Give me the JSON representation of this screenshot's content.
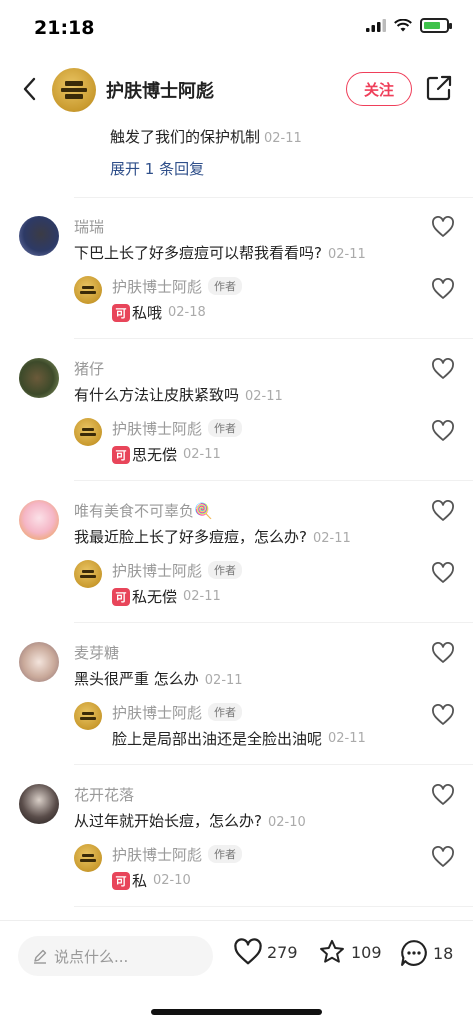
{
  "status_bar": {
    "time": "21:18"
  },
  "header": {
    "author_name": "护肤博士阿彪",
    "follow_label": "关注"
  },
  "previous_reply": {
    "text": "触发了我们的保护机制",
    "date": "02-11"
  },
  "expand_label": "展开 1 条回复",
  "author_tag": "作者",
  "comments": [
    {
      "user": "瑞瑞",
      "text": "下巴上长了好多痘痘可以帮我看看吗?",
      "date": "02-11",
      "reply": {
        "user": "护肤博士阿彪",
        "text": "私哦",
        "date": "02-18"
      }
    },
    {
      "user": "猪仔",
      "text": "有什么方法让皮肤紧致吗",
      "date": "02-11",
      "reply": {
        "user": "护肤博士阿彪",
        "text": "思无偿",
        "date": "02-11"
      }
    },
    {
      "user": "唯有美食不可辜负🍭",
      "text": "我最近脸上长了好多痘痘，怎么办?",
      "date": "02-11",
      "reply": {
        "user": "护肤博士阿彪",
        "text": "私无偿",
        "date": "02-11"
      }
    },
    {
      "user": "麦芽糖",
      "text": "黑头很严重 怎么办",
      "date": "02-11",
      "reply": {
        "user": "护肤博士阿彪",
        "text": "脸上是局部出油还是全脸出油呢",
        "date": "02-11"
      }
    },
    {
      "user": "花开花落",
      "text": "从过年就开始长痘，怎么办?",
      "date": "02-10",
      "reply": {
        "user": "护肤博士阿彪",
        "text": "私",
        "date": "02-10"
      }
    }
  ],
  "bottom_bar": {
    "input_placeholder": "说点什么...",
    "likes": "279",
    "favorites": "109",
    "comments": "18"
  },
  "colors": {
    "accent": "#ef3f5a",
    "link": "#2f4f8a",
    "author_avatar_gold": "#c99a2e"
  }
}
